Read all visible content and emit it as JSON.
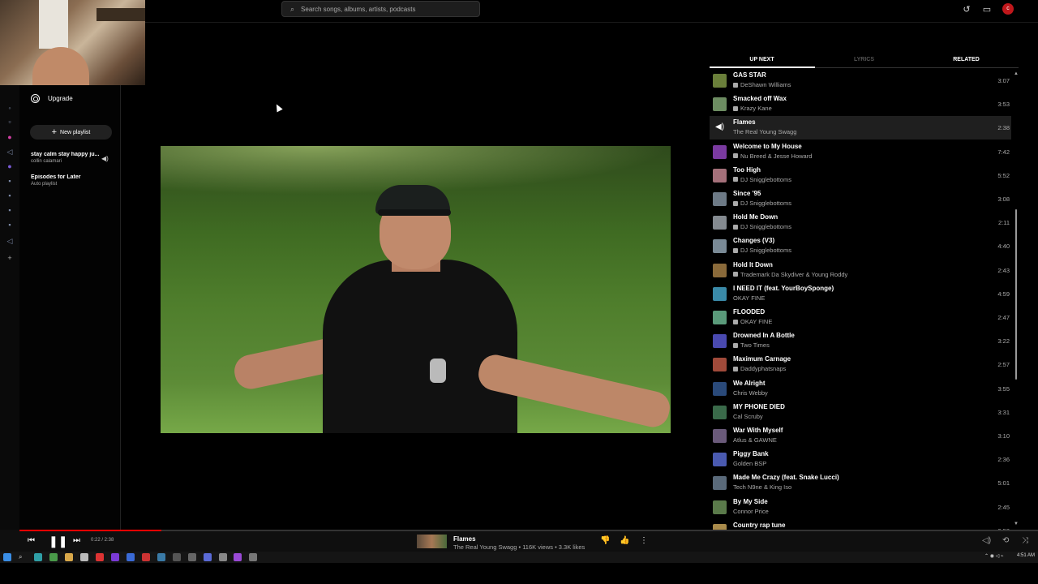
{
  "search": {
    "placeholder": "Search songs, albums, artists, podcasts"
  },
  "header": {
    "avatar_letter": "c",
    "accent": "#c0171b"
  },
  "sidebar": {
    "upgrade_label": "Upgrade",
    "new_playlist_label": "New playlist",
    "playlists": [
      {
        "title": "stay calm stay happy ju...",
        "subtitle": "collin calamari"
      },
      {
        "title": "Episodes for Later",
        "subtitle": "Auto playlist"
      }
    ]
  },
  "tabs": {
    "up_next": "UP NEXT",
    "lyrics": "LYRICS",
    "related": "RELATED"
  },
  "queue": [
    {
      "title": "GAS STAR",
      "artist": "DeShawn Williams",
      "duration": "3:07",
      "explicit": true,
      "color": "#6a7f3a"
    },
    {
      "title": "Smacked off Wax",
      "artist": "Krazy Kane",
      "duration": "3:53",
      "explicit": true,
      "color": "#6d8d62"
    },
    {
      "title": "Flames",
      "artist": "The Real Young Swagg",
      "duration": "2:38",
      "explicit": false,
      "active": true,
      "color": "#7a6a4a"
    },
    {
      "title": "Welcome to My House",
      "artist": "Nu Breed & Jesse Howard",
      "duration": "7:42",
      "explicit": true,
      "color": "#7a3aa0"
    },
    {
      "title": "Too High",
      "artist": "DJ Snigglebottoms",
      "duration": "5:52",
      "explicit": true,
      "color": "#a4707a"
    },
    {
      "title": "Since '95",
      "artist": "DJ Snigglebottoms",
      "duration": "3:08",
      "explicit": true,
      "color": "#6d7a86"
    },
    {
      "title": "Hold Me Down",
      "artist": "DJ Snigglebottoms",
      "duration": "2:11",
      "explicit": true,
      "color": "#848a90"
    },
    {
      "title": "Changes (V3)",
      "artist": "DJ Snigglebottoms",
      "duration": "4:40",
      "explicit": true,
      "color": "#7a8a96"
    },
    {
      "title": "Hold It Down",
      "artist": "Trademark Da Skydiver & Young Roddy",
      "duration": "2:43",
      "explicit": true,
      "color": "#8a6a3a"
    },
    {
      "title": "I NEED IT (feat. YourBoySponge)",
      "artist": "OKAY FINE",
      "duration": "4:59",
      "explicit": false,
      "color": "#3a8aa8"
    },
    {
      "title": "FLOODED",
      "artist": "OKAY FINE",
      "duration": "2:47",
      "explicit": true,
      "color": "#5a9a7a"
    },
    {
      "title": "Drowned In A Bottle",
      "artist": "Two Times",
      "duration": "3:22",
      "explicit": true,
      "color": "#4a4ab0"
    },
    {
      "title": "Maximum Carnage",
      "artist": "Daddyphatsnaps",
      "duration": "2:57",
      "explicit": true,
      "color": "#a04a3a"
    },
    {
      "title": "We Alright",
      "artist": "Chris Webby",
      "duration": "3:55",
      "explicit": false,
      "color": "#2a4a7a"
    },
    {
      "title": "MY PHONE DIED",
      "artist": "Cal Scruby",
      "duration": "3:31",
      "explicit": false,
      "color": "#3a6a4a"
    },
    {
      "title": "War With Myself",
      "artist": "Atlus & GAWNE",
      "duration": "3:10",
      "explicit": false,
      "color": "#6a5a7a"
    },
    {
      "title": "Piggy Bank",
      "artist": "Golden BSP",
      "duration": "2:36",
      "explicit": false,
      "color": "#4a5ab0"
    },
    {
      "title": "Made Me Crazy (feat. Snake Lucci)",
      "artist": "Tech N9ne & King Iso",
      "duration": "5:01",
      "explicit": false,
      "color": "#5a6a7a"
    },
    {
      "title": "By My Side",
      "artist": "Connor Price",
      "duration": "2:45",
      "explicit": false,
      "color": "#5a7a4a"
    },
    {
      "title": "Country rap tune",
      "artist": "",
      "duration": "2:58",
      "explicit": false,
      "color": "#a88a4a"
    }
  ],
  "player": {
    "time": "0:22 / 2:38",
    "progress": 0.139,
    "title": "Flames",
    "subtitle": "The Real Young Swagg • 116K views • 3.3K likes"
  },
  "taskbar": {
    "clock": "4:51 AM"
  }
}
